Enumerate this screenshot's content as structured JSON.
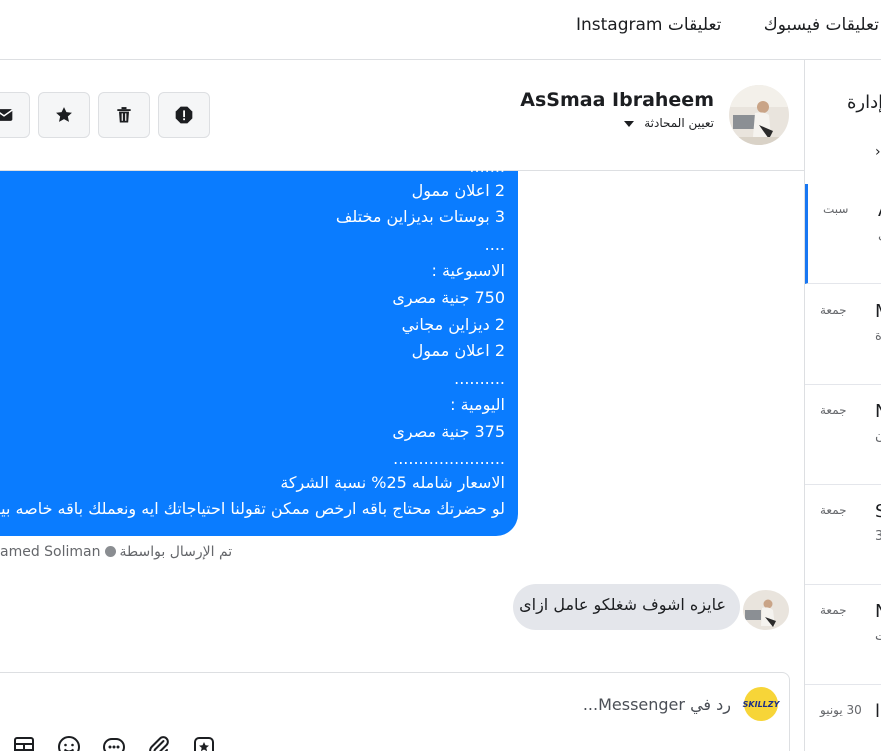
{
  "tabs": {
    "facebook_comments": "تعليقات فيسبوك",
    "instagram_comments": "تعليقات Instagram"
  },
  "inbox": {
    "title": "إدارة",
    "conversations": [
      {
        "day": "سبت",
        "initial": "A",
        "snippet": "ي"
      },
      {
        "day": "جمعة",
        "initial": "M",
        "snippet": "ة"
      },
      {
        "day": "جمعة",
        "initial": "N",
        "snippet": "ن"
      },
      {
        "day": "جمعة",
        "initial": "S",
        "snippet": "3"
      },
      {
        "day": "جمعة",
        "initial": "N",
        "snippet": "ت"
      },
      {
        "day": "30 يونيو",
        "initial": "ا",
        "snippet": ""
      }
    ]
  },
  "header": {
    "contact_name": "AsSmaa Ibraheem",
    "assign_label": "تعيين المحادثة",
    "icons": [
      "email-icon",
      "star-icon",
      "trash-icon",
      "alert-icon"
    ]
  },
  "messages": {
    "outgoing_lines": [
      "2 اعلان ممول",
      "3 بوستات بديزاين مختلف",
      "....",
      "الاسبوعية :",
      "750 جنية مصرى",
      "2 ديزاين مجاني",
      "2 اعلان ممول",
      "..........",
      "اليومية :",
      "375 جنية مصرى",
      "......................",
      "الاسعار شامله 25% نسبة الشركة",
      "لو حضرتك محتاج باقه ارخص ممكن تقولنا احتياجاتك ايه ونعملك باقه خاصه بيك"
    ],
    "sent_by_label": "تم الإرسال بواسطة",
    "sent_by_agent": "amed Soliman",
    "incoming_text": "عايزه اشوف شغلكو عامل ازاى"
  },
  "composer": {
    "placeholder": "رد في Messenger...",
    "page_logo_text": "SKILLZY"
  },
  "colors": {
    "accent": "#1877f2",
    "outgoing_bubble": "#0a7cff",
    "incoming_bubble": "#e4e6eb"
  }
}
